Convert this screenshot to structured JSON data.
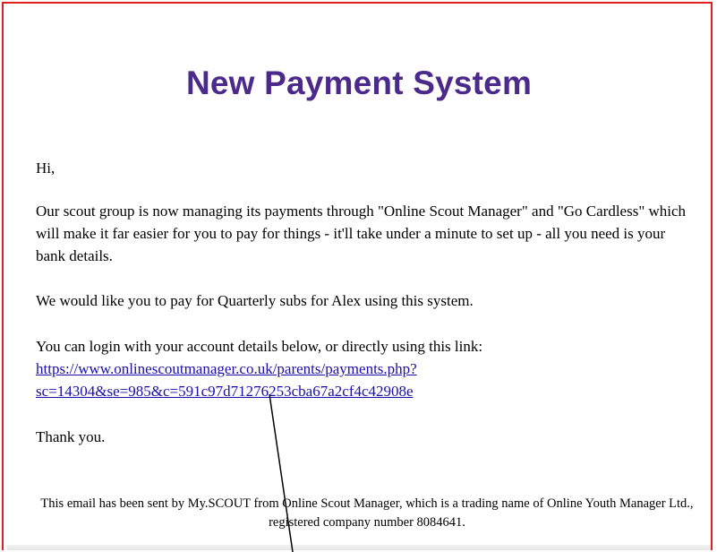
{
  "email": {
    "title": "New Payment System",
    "greeting": "Hi,",
    "paragraph1": "Our scout group is now managing its payments through \"Online Scout Manager\" and \"Go Cardless\" which will make it far easier for you to pay for things - it'll take under a minute to set up - all you need is your bank details.",
    "paragraph2": "We would like you to pay for Quarterly subs for Alex using this system.",
    "paragraph3": "You can login with your account details below, or directly using this link:",
    "link_line1": "https://www.onlinescoutmanager.co.uk/parents/payments.php?",
    "link_line2": "sc=14304&se=985&c=591c97d71276253cba67a2cf4c42908e",
    "closing": "Thank you.",
    "footer": "This email has been sent by My.SCOUT from Online Scout Manager, which is a trading name of Online Youth Manager Ltd., registered company number 8084641."
  },
  "colors": {
    "title": "#4b2a8c",
    "link": "#1a0dab",
    "frame_border": "#e02020"
  }
}
